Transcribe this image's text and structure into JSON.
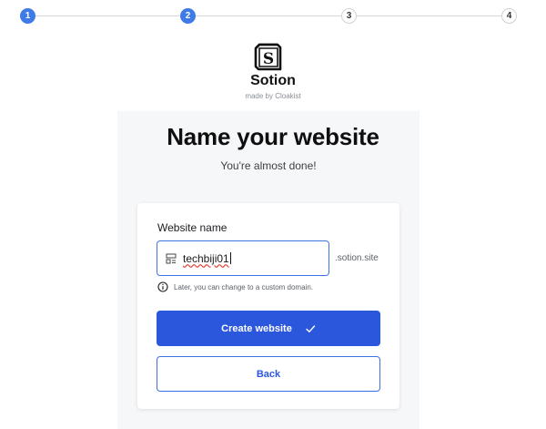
{
  "stepper": {
    "steps": [
      {
        "label": "1",
        "state": "done"
      },
      {
        "label": "2",
        "state": "done"
      },
      {
        "label": "3",
        "state": "todo"
      },
      {
        "label": "4",
        "state": "todo"
      }
    ],
    "current_step": 2,
    "total_steps": 4
  },
  "brand": {
    "logo_icon": "sotion-logo-icon",
    "logo_letter": "S",
    "name": "Sotion",
    "made_by": "made by Cloakist"
  },
  "page": {
    "title": "Name your website",
    "subtitle": "You're almost done!"
  },
  "form": {
    "field_label": "Website name",
    "input_value": "techbiji01",
    "input_icon": "layout-icon",
    "domain_suffix": ".sotion.site",
    "hint_icon": "info-icon",
    "hint": "Later, you can change to a custom domain."
  },
  "actions": {
    "create_label": "Create website",
    "create_icon": "check-icon",
    "back_label": "Back"
  },
  "colors": {
    "primary": "#2b57dd",
    "step_active": "#3f7be6",
    "panel_bg": "#f6f7f9"
  }
}
